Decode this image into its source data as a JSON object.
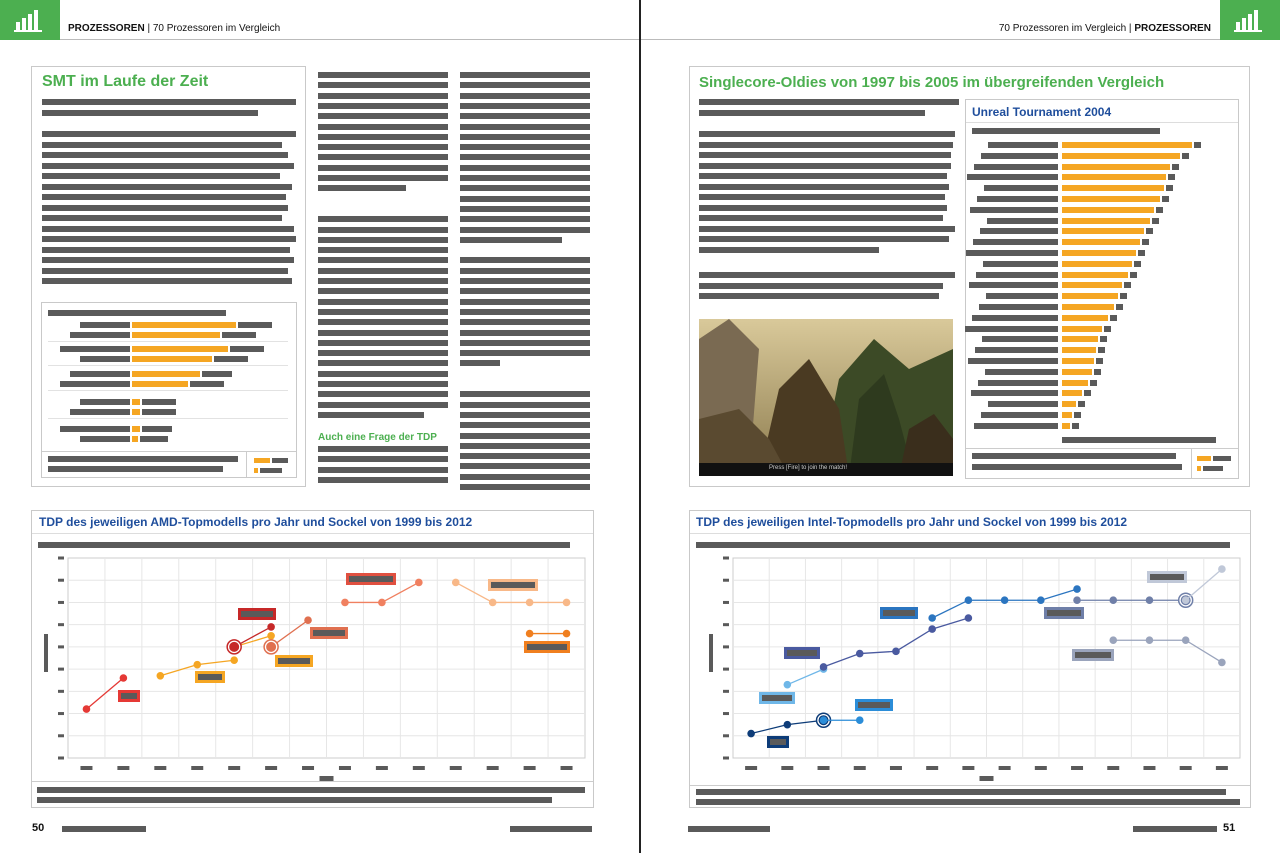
{
  "header": {
    "left_section": "PROZESSOREN",
    "left_sep": " | ",
    "left_topic": "70 Prozessoren im Vergleich",
    "right_topic": "70 Prozessoren im Vergleich",
    "right_sep": " | ",
    "right_section": "PROZESSOREN"
  },
  "left_page": {
    "box_title": "SMT im Laufe der Zeit",
    "subheading": "Auch eine Frage der TDP",
    "chart_title": "TDP des jeweiligen AMD-Topmodells pro Jahr und Sockel von 1999 bis 2012",
    "page_number": "50"
  },
  "right_page": {
    "box_title": "Singlecore-Oldies von 1997 bis 2005 im übergreifenden Vergleich",
    "bench_title": "Unreal Tournament 2004",
    "game_caption": "Press [Fire] to join the match!",
    "chart_title": "TDP des jeweiligen Intel-Topmodells pro Jahr und Sockel von 1999 bis 2012",
    "page_number": "51"
  },
  "colors": {
    "accent_green": "#4caf50",
    "title_blue": "#1f4e9c",
    "bar_orange": "#f5a623",
    "text_gray": "#5a5a5a"
  }
}
